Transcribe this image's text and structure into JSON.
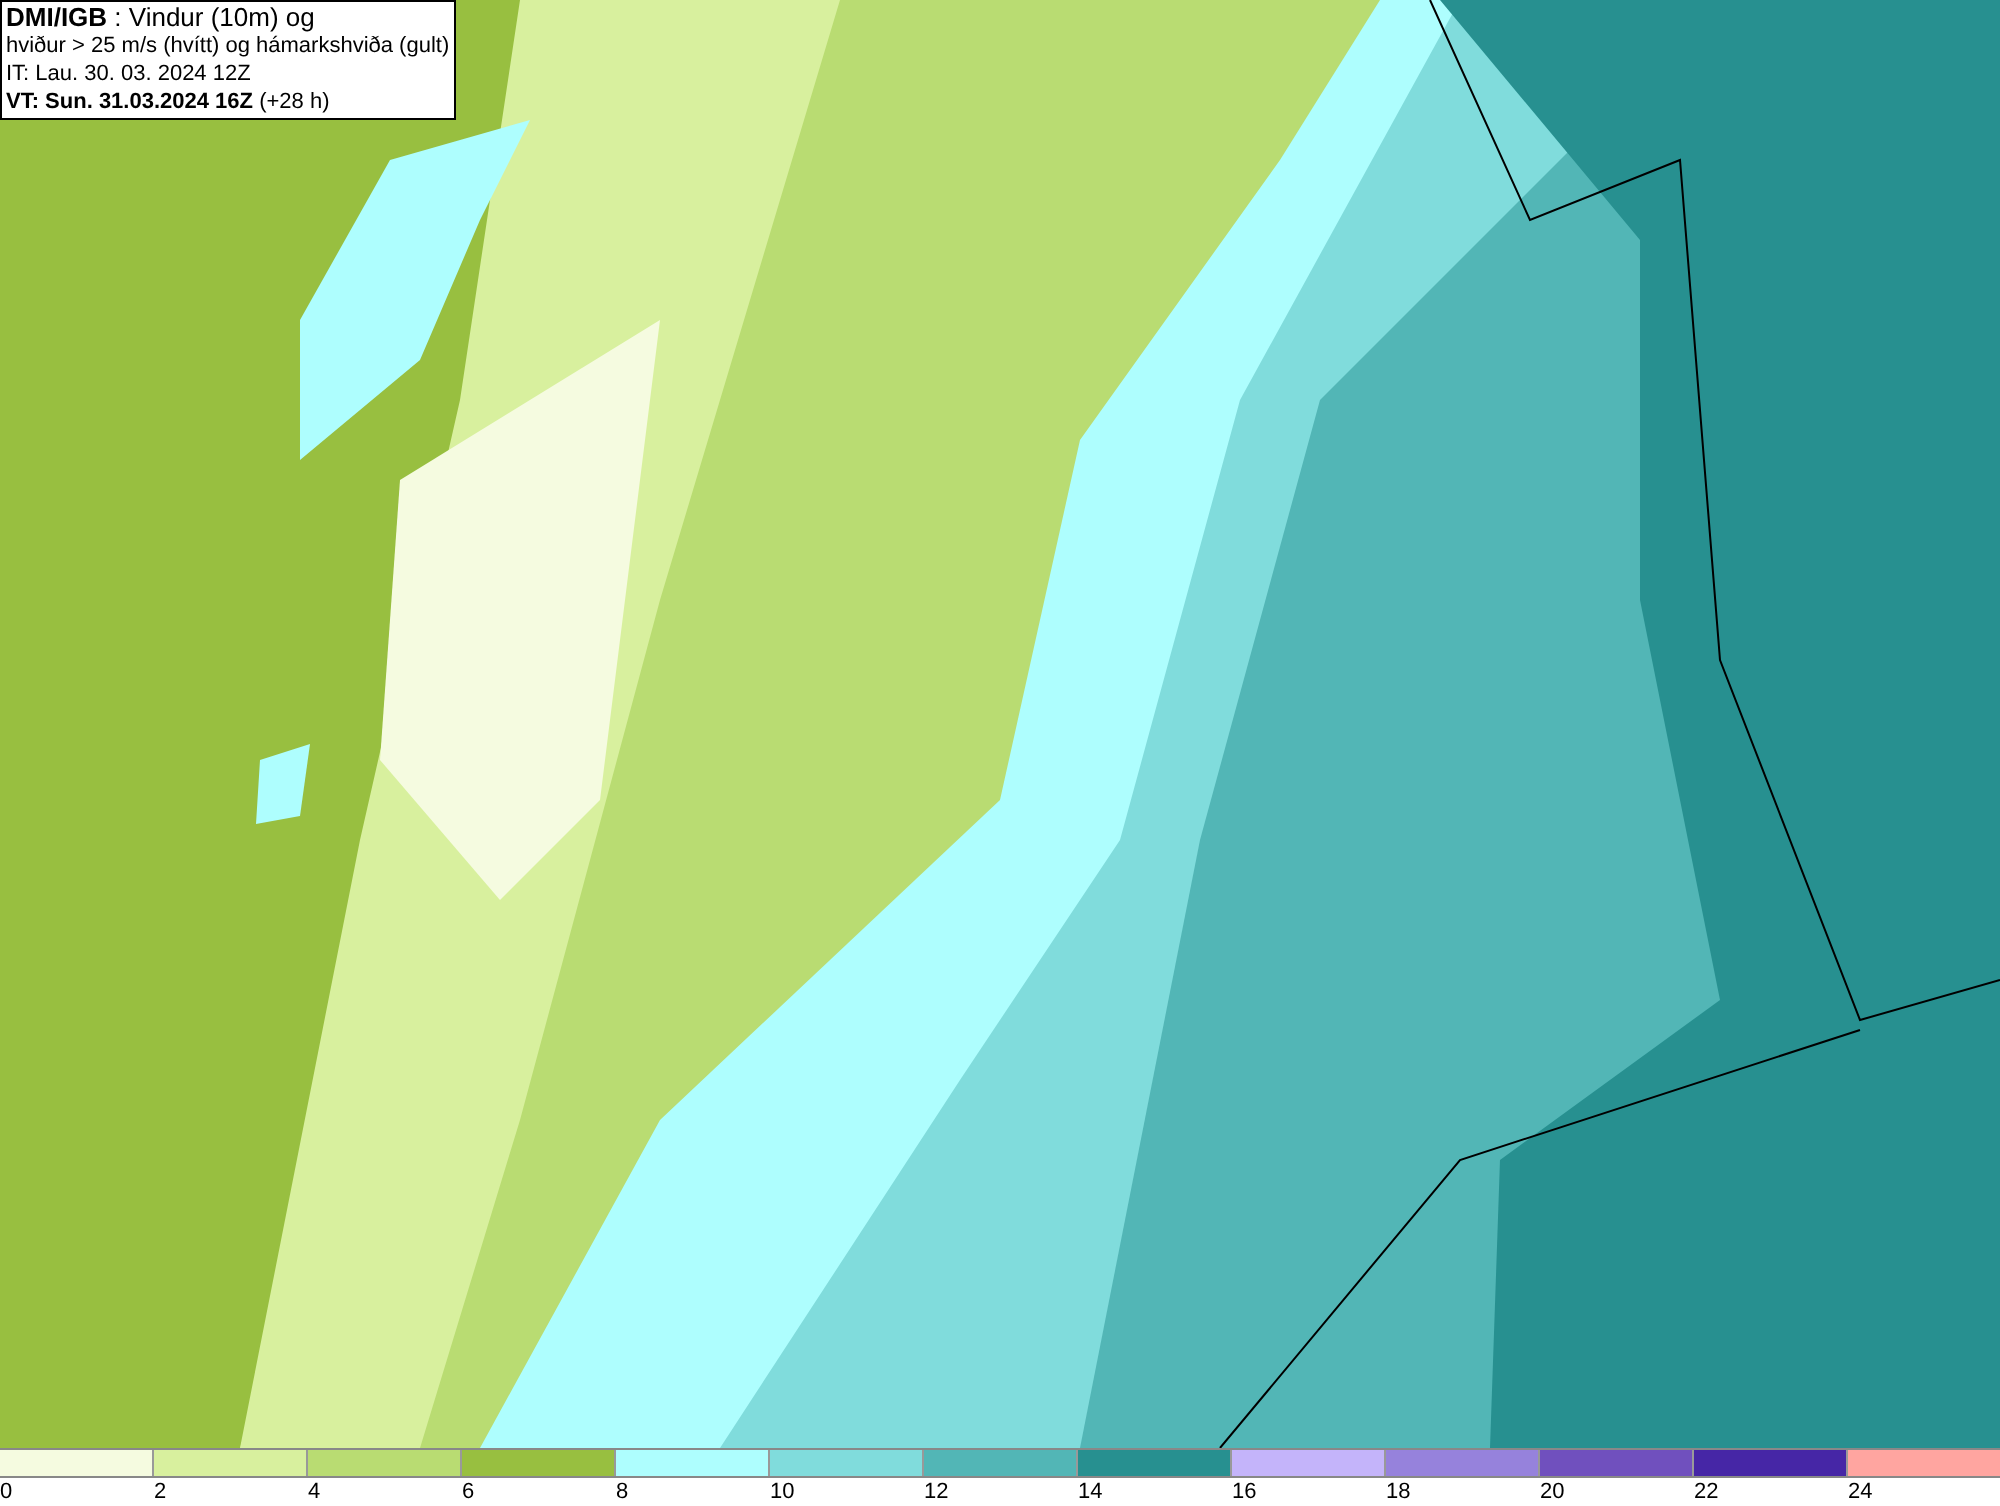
{
  "title_box": {
    "lines": [
      "**DMI/IGB** : Vindur (10m) og",
      "hviður > 25 m/s (hvítt) og hámarkshviða (gult)",
      "IT: Lau. 30. 03. 2024 12Z",
      "**VT: Sun. 31.03.2024 16Z** (+28 h)"
    ]
  },
  "legend": {
    "bins": [
      {
        "label": "0",
        "color": "#f5fbe0"
      },
      {
        "label": "2",
        "color": "#d8f09e"
      },
      {
        "label": "4",
        "color": "#b9dc72"
      },
      {
        "label": "6",
        "color": "#98bf40"
      },
      {
        "label": "8",
        "color": "#aefefe"
      },
      {
        "label": "10",
        "color": "#80dcdc"
      },
      {
        "label": "12",
        "color": "#52b6b6"
      },
      {
        "label": "14",
        "color": "#279090"
      },
      {
        "label": "16",
        "color": "#c4b4fa"
      },
      {
        "label": "18",
        "color": "#9682dc"
      },
      {
        "label": "20",
        "color": "#7050be"
      },
      {
        "label": "22",
        "color": "#4626a6"
      },
      {
        "label": "24",
        "color": "#ffa5a0"
      }
    ]
  }
}
